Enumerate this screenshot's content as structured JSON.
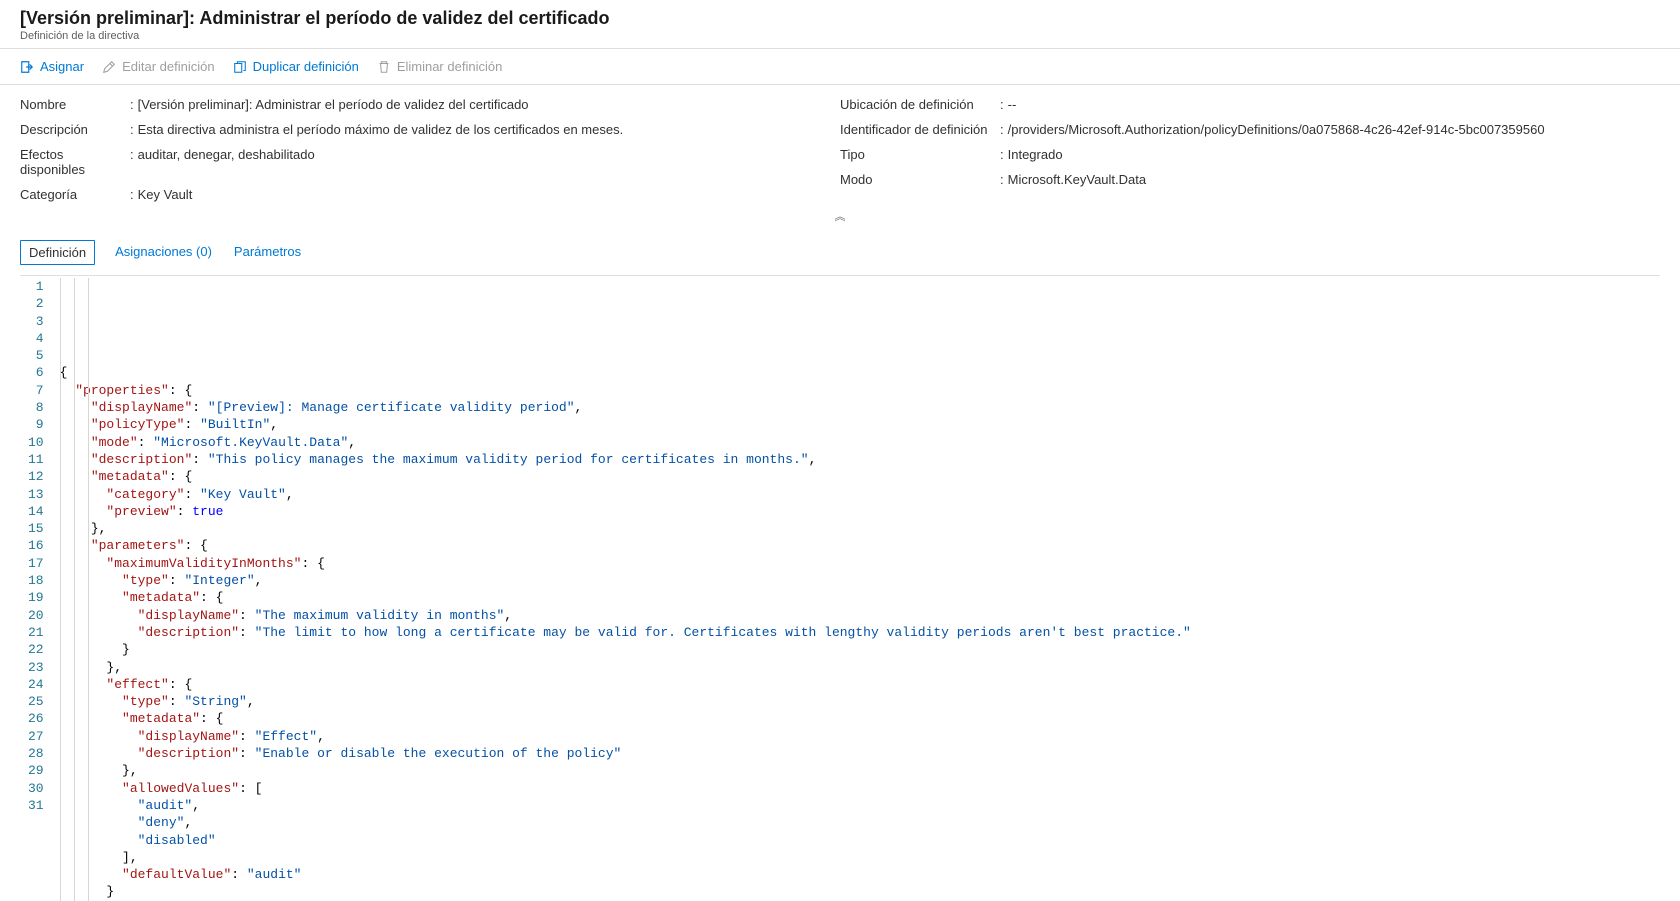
{
  "header": {
    "title": "[Versión preliminar]: Administrar el período de validez del certificado",
    "subtitle": "Definición de la directiva"
  },
  "toolbar": {
    "assign": "Asignar",
    "edit": "Editar definición",
    "duplicate": "Duplicar definición",
    "delete": "Eliminar definición"
  },
  "essentials": {
    "left": {
      "name_label": "Nombre",
      "name_value": "[Versión preliminar]: Administrar el período de validez del certificado",
      "description_label": "Descripción",
      "description_value": "Esta directiva administra el período máximo de validez de los certificados en meses.",
      "effects_label": "Efectos disponibles",
      "effects_value": "auditar, denegar, deshabilitado",
      "category_label": "Categoría",
      "category_value": "Key Vault"
    },
    "right": {
      "location_label": "Ubicación de definición",
      "location_value": "--",
      "defid_label": "Identificador de definición",
      "defid_value": "/providers/Microsoft.Authorization/policyDefinitions/0a075868-4c26-42ef-914c-5bc007359560",
      "type_label": "Tipo",
      "type_value": "Integrado",
      "mode_label": "Modo",
      "mode_value": "Microsoft.KeyVault.Data"
    }
  },
  "tabs": {
    "definition": "Definición",
    "assignments": "Asignaciones (0)",
    "parameters": "Parámetros"
  },
  "code_tokens": [
    [
      [
        "pun",
        "{"
      ]
    ],
    [
      [
        "sp",
        "  "
      ],
      [
        "key",
        "\"properties\""
      ],
      [
        "pun",
        ": {"
      ]
    ],
    [
      [
        "sp",
        "    "
      ],
      [
        "key",
        "\"displayName\""
      ],
      [
        "pun",
        ": "
      ],
      [
        "str",
        "\"[Preview]: Manage certificate validity period\""
      ],
      [
        "pun",
        ","
      ]
    ],
    [
      [
        "sp",
        "    "
      ],
      [
        "key",
        "\"policyType\""
      ],
      [
        "pun",
        ": "
      ],
      [
        "str",
        "\"BuiltIn\""
      ],
      [
        "pun",
        ","
      ]
    ],
    [
      [
        "sp",
        "    "
      ],
      [
        "key",
        "\"mode\""
      ],
      [
        "pun",
        ": "
      ],
      [
        "str",
        "\"Microsoft.KeyVault.Data\""
      ],
      [
        "pun",
        ","
      ]
    ],
    [
      [
        "sp",
        "    "
      ],
      [
        "key",
        "\"description\""
      ],
      [
        "pun",
        ": "
      ],
      [
        "str",
        "\"This policy manages the maximum validity period for certificates in months.\""
      ],
      [
        "pun",
        ","
      ]
    ],
    [
      [
        "sp",
        "    "
      ],
      [
        "key",
        "\"metadata\""
      ],
      [
        "pun",
        ": {"
      ]
    ],
    [
      [
        "sp",
        "      "
      ],
      [
        "key",
        "\"category\""
      ],
      [
        "pun",
        ": "
      ],
      [
        "str",
        "\"Key Vault\""
      ],
      [
        "pun",
        ","
      ]
    ],
    [
      [
        "sp",
        "      "
      ],
      [
        "key",
        "\"preview\""
      ],
      [
        "pun",
        ": "
      ],
      [
        "bool",
        "true"
      ]
    ],
    [
      [
        "sp",
        "    "
      ],
      [
        "pun",
        "},"
      ]
    ],
    [
      [
        "sp",
        "    "
      ],
      [
        "key",
        "\"parameters\""
      ],
      [
        "pun",
        ": {"
      ]
    ],
    [
      [
        "sp",
        "      "
      ],
      [
        "key",
        "\"maximumValidityInMonths\""
      ],
      [
        "pun",
        ": {"
      ]
    ],
    [
      [
        "sp",
        "        "
      ],
      [
        "key",
        "\"type\""
      ],
      [
        "pun",
        ": "
      ],
      [
        "str",
        "\"Integer\""
      ],
      [
        "pun",
        ","
      ]
    ],
    [
      [
        "sp",
        "        "
      ],
      [
        "key",
        "\"metadata\""
      ],
      [
        "pun",
        ": {"
      ]
    ],
    [
      [
        "sp",
        "          "
      ],
      [
        "key",
        "\"displayName\""
      ],
      [
        "pun",
        ": "
      ],
      [
        "str",
        "\"The maximum validity in months\""
      ],
      [
        "pun",
        ","
      ]
    ],
    [
      [
        "sp",
        "          "
      ],
      [
        "key",
        "\"description\""
      ],
      [
        "pun",
        ": "
      ],
      [
        "str",
        "\"The limit to how long a certificate may be valid for. Certificates with lengthy validity periods aren't best practice.\""
      ]
    ],
    [
      [
        "sp",
        "        "
      ],
      [
        "pun",
        "}"
      ]
    ],
    [
      [
        "sp",
        "      "
      ],
      [
        "pun",
        "},"
      ]
    ],
    [
      [
        "sp",
        "      "
      ],
      [
        "key",
        "\"effect\""
      ],
      [
        "pun",
        ": {"
      ]
    ],
    [
      [
        "sp",
        "        "
      ],
      [
        "key",
        "\"type\""
      ],
      [
        "pun",
        ": "
      ],
      [
        "str",
        "\"String\""
      ],
      [
        "pun",
        ","
      ]
    ],
    [
      [
        "sp",
        "        "
      ],
      [
        "key",
        "\"metadata\""
      ],
      [
        "pun",
        ": {"
      ]
    ],
    [
      [
        "sp",
        "          "
      ],
      [
        "key",
        "\"displayName\""
      ],
      [
        "pun",
        ": "
      ],
      [
        "str",
        "\"Effect\""
      ],
      [
        "pun",
        ","
      ]
    ],
    [
      [
        "sp",
        "          "
      ],
      [
        "key",
        "\"description\""
      ],
      [
        "pun",
        ": "
      ],
      [
        "str",
        "\"Enable or disable the execution of the policy\""
      ]
    ],
    [
      [
        "sp",
        "        "
      ],
      [
        "pun",
        "},"
      ]
    ],
    [
      [
        "sp",
        "        "
      ],
      [
        "key",
        "\"allowedValues\""
      ],
      [
        "pun",
        ": ["
      ]
    ],
    [
      [
        "sp",
        "          "
      ],
      [
        "str",
        "\"audit\""
      ],
      [
        "pun",
        ","
      ]
    ],
    [
      [
        "sp",
        "          "
      ],
      [
        "str",
        "\"deny\""
      ],
      [
        "pun",
        ","
      ]
    ],
    [
      [
        "sp",
        "          "
      ],
      [
        "str",
        "\"disabled\""
      ]
    ],
    [
      [
        "sp",
        "        "
      ],
      [
        "pun",
        "],"
      ]
    ],
    [
      [
        "sp",
        "        "
      ],
      [
        "key",
        "\"defaultValue\""
      ],
      [
        "pun",
        ": "
      ],
      [
        "str",
        "\"audit\""
      ]
    ],
    [
      [
        "sp",
        "      "
      ],
      [
        "pun",
        "}"
      ]
    ]
  ]
}
